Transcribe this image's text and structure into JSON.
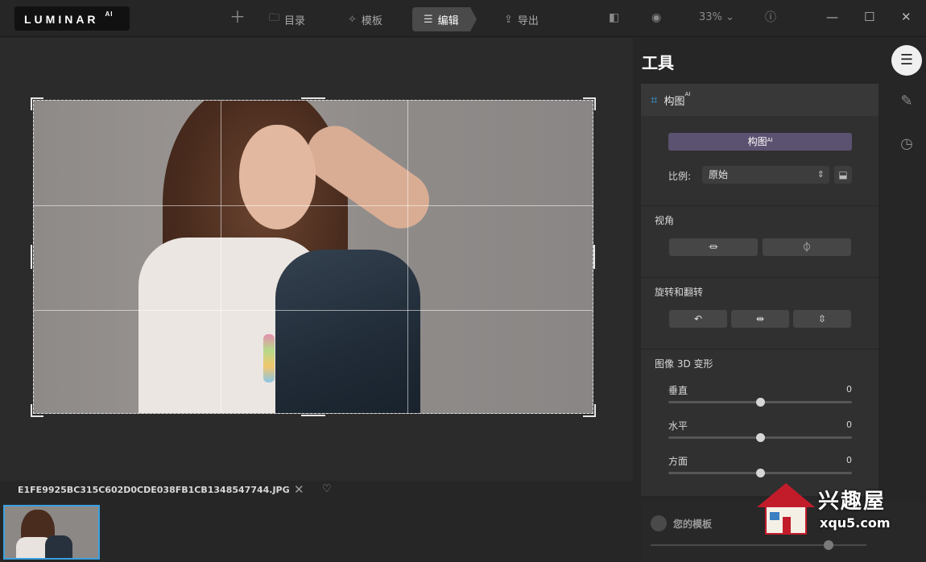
{
  "header": {
    "logo_text": "LUMINAR",
    "logo_sup": "AI",
    "add_icon": "plus-icon",
    "tabs": [
      {
        "label": "目录",
        "icon": "folder-icon"
      },
      {
        "label": "模板",
        "icon": "sparkle-icon"
      },
      {
        "label": "编辑",
        "icon": "sliders-icon",
        "active": true
      },
      {
        "label": "导出",
        "icon": "share-icon"
      }
    ],
    "zoom": "33%",
    "zoom_chevron": "⌄"
  },
  "canvas": {
    "filename": "E1FE9925BC315C602D0CDE038FB1CB1348547744.JPG"
  },
  "tools": {
    "title": "工具",
    "crop_section": {
      "title": "构图",
      "title_sup": "AI",
      "compose_button": "构图",
      "compose_sup": "AI",
      "ratio_label": "比例:",
      "ratio_value": "原始"
    },
    "perspective": {
      "title": "视角"
    },
    "rotate_flip": {
      "title": "旋转和翻转"
    },
    "transform3d": {
      "title": "图像 3D 变形",
      "sliders": [
        {
          "label": "垂直",
          "value": "0",
          "level": 0.5
        },
        {
          "label": "水平",
          "value": "0",
          "level": 0.5
        },
        {
          "label": "方面",
          "value": "0",
          "level": 0.5
        }
      ]
    }
  },
  "templates": {
    "label": "您的模板",
    "level": 0.82
  },
  "watermark": {
    "cn": "兴趣屋",
    "url": "xqu5.com"
  },
  "colors": {
    "accent": "#3aa0e0",
    "compose_button": "#5b5170",
    "watermark_red": "#c21c2b"
  }
}
